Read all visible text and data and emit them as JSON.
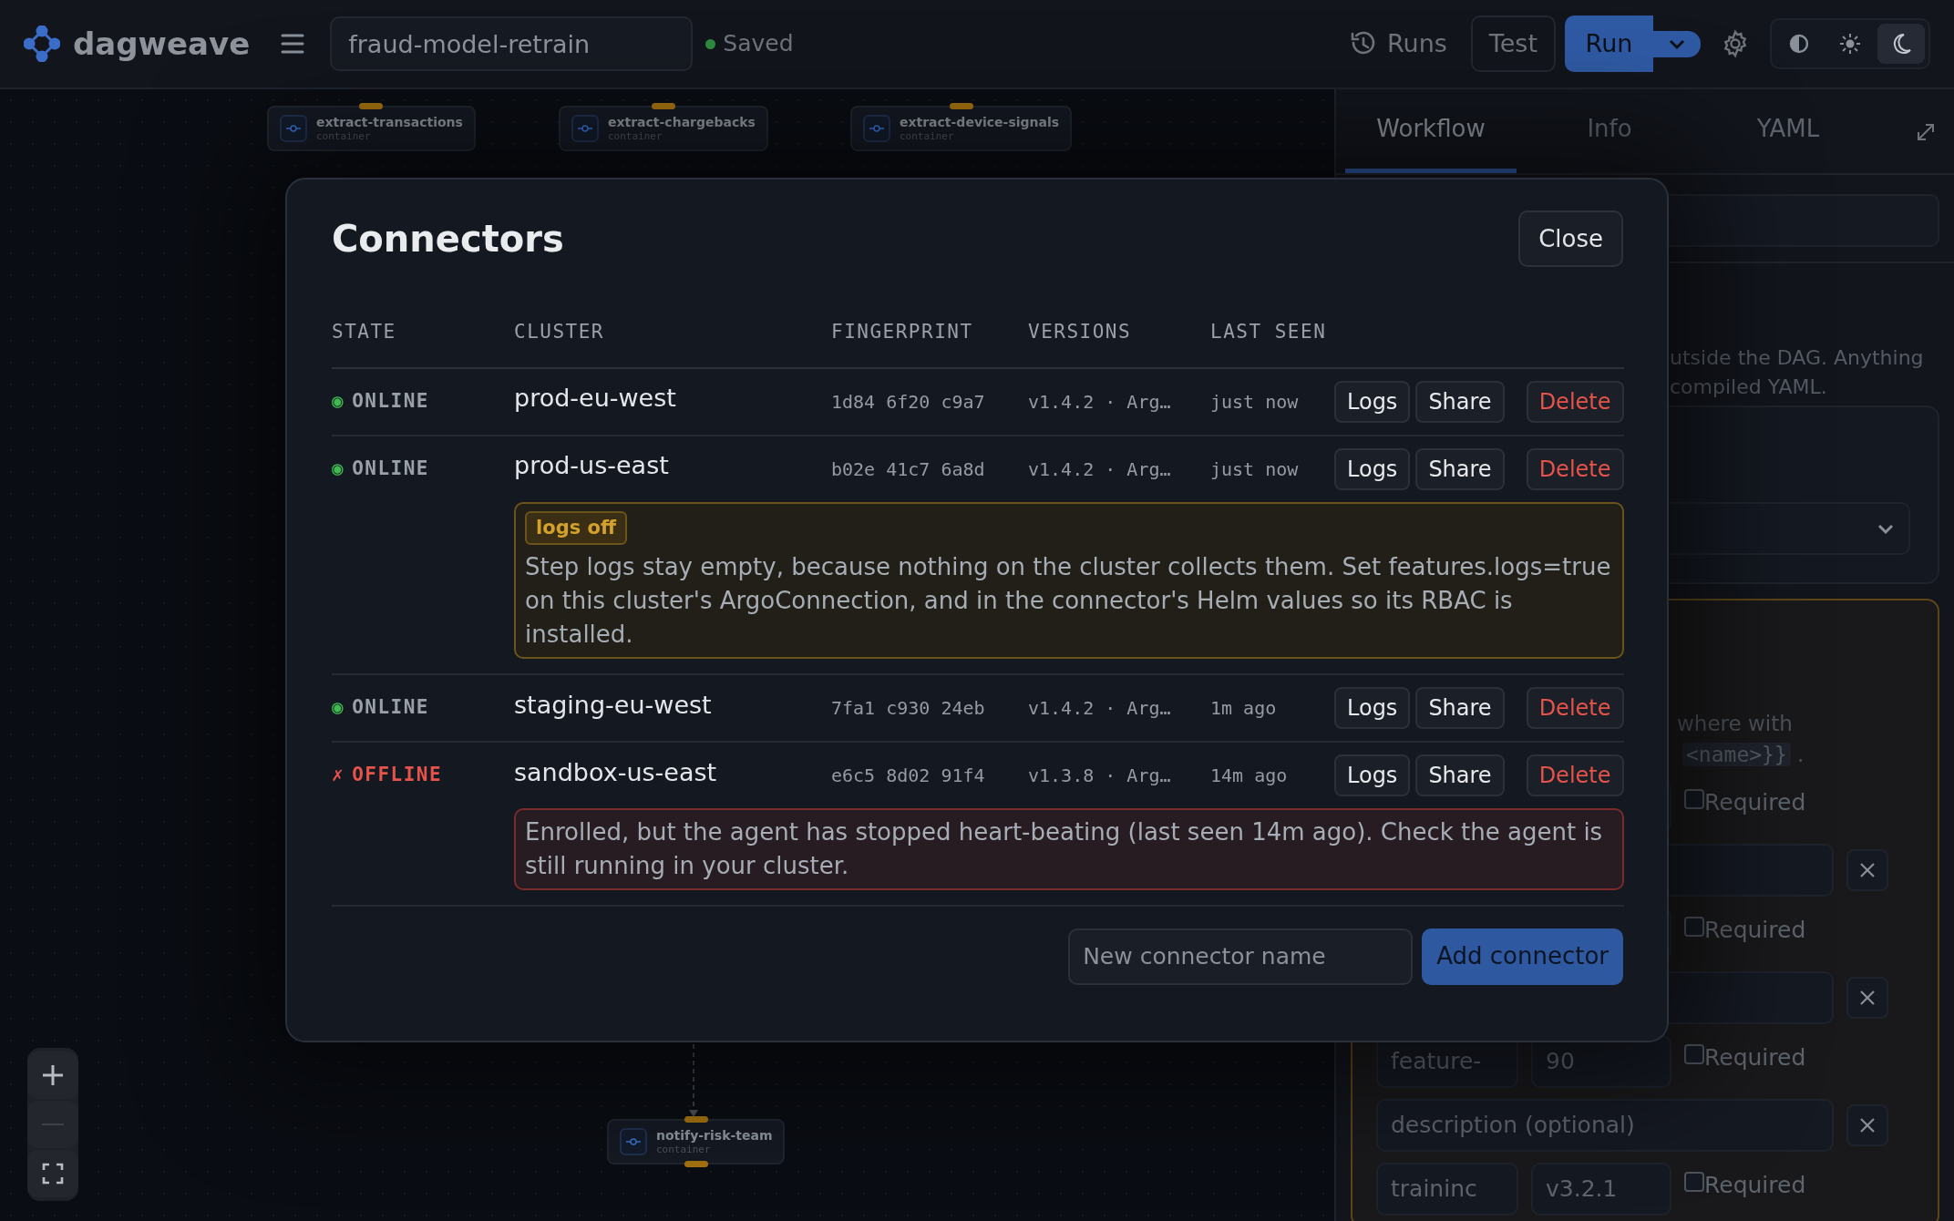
{
  "topbar": {
    "app_name": "dagweave",
    "workflow_name": "fraud-model-retrain",
    "save_status": "Saved",
    "saved": true,
    "runs_label": "Runs",
    "test_label": "Test",
    "run_label": "Run",
    "theme_modes": [
      {
        "kind": "auto",
        "selected": false
      },
      {
        "kind": "light",
        "selected": false
      },
      {
        "kind": "dark",
        "selected": true
      }
    ]
  },
  "canvas": {
    "nodes": [
      {
        "name": "extract-transactions",
        "type": "container"
      },
      {
        "name": "extract-chargebacks",
        "type": "container"
      },
      {
        "name": "extract-device-signals",
        "type": "container"
      },
      {
        "name": "notify-risk-team",
        "type": "container"
      }
    ]
  },
  "panel": {
    "tabs": [
      {
        "label": "Workflow",
        "selected": true
      },
      {
        "label": "Info",
        "selected": false
      },
      {
        "label": "YAML",
        "selected": false
      }
    ],
    "description_lines": [
      "utside the DAG. Anything",
      "compiled YAML."
    ],
    "params_hint": "where with",
    "params_hint_code": "<name>}}",
    "params_hint_tail": ".",
    "params": [
      {
        "required_label": "Required",
        "required": false
      },
      {
        "required_label": "Required",
        "required": false
      },
      {
        "name": "feature-",
        "value": "90",
        "required_label": "Required",
        "required": false,
        "description_placeholder": "description (optional)"
      },
      {
        "name": "traininc",
        "value": "v3.2.1",
        "required_label": "Required",
        "required": false
      }
    ]
  },
  "dialog": {
    "title": "Connectors",
    "close_label": "Close",
    "columns": [
      "STATE",
      "CLUSTER",
      "FINGERPRINT",
      "VERSIONS",
      "LAST SEEN"
    ],
    "rows": [
      {
        "kind": "online",
        "state_icon": "◉",
        "state": "ONLINE",
        "cluster": "prod-eu-west",
        "fingerprint": "1d84 6f20 c9a7",
        "versions": "v1.4.2 · Arg…",
        "last_seen": "just now",
        "actions": [
          "Logs",
          "Share",
          "Delete"
        ]
      },
      {
        "kind": "online",
        "state_icon": "◉",
        "state": "ONLINE",
        "cluster": "prod-us-east",
        "fingerprint": "b02e 41c7 6a8d",
        "versions": "v1.4.2 · Arg…",
        "last_seen": "just now",
        "actions": [
          "Logs",
          "Share",
          "Delete"
        ],
        "note": {
          "kind": "warning",
          "badge": "logs off",
          "text": "Step logs stay empty, because nothing on the cluster collects them. Set features.logs=true on this cluster's ArgoConnection, and in the connector's Helm values so its RBAC is installed."
        }
      },
      {
        "kind": "online",
        "state_icon": "◉",
        "state": "ONLINE",
        "cluster": "staging-eu-west",
        "fingerprint": "7fa1 c930 24eb",
        "versions": "v1.4.2 · Arg…",
        "last_seen": "1m ago",
        "actions": [
          "Logs",
          "Share",
          "Delete"
        ]
      },
      {
        "kind": "offline",
        "state_icon": "✗",
        "state": "OFFLINE",
        "cluster": "sandbox-us-east",
        "fingerprint": "e6c5 8d02 91f4",
        "versions": "v1.3.8 · Arg…",
        "last_seen": "14m ago",
        "actions": [
          "Logs",
          "Share",
          "Delete"
        ],
        "note": {
          "kind": "error",
          "text": "Enrolled, but the agent has stopped heart-beating (last seen 14m ago). Check the agent is still running in your cluster."
        }
      }
    ],
    "new_connector_placeholder": "New connector name",
    "add_label": "Add connector"
  }
}
